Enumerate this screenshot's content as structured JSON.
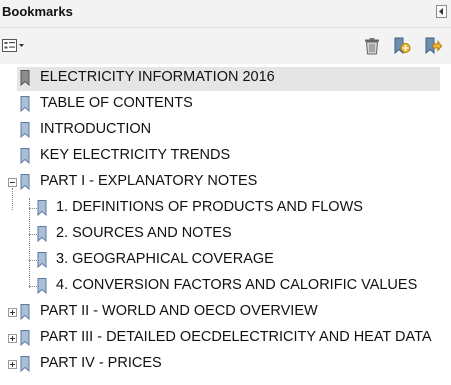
{
  "panel": {
    "title": "Bookmarks",
    "collapse_icon": "triangle-left-icon"
  },
  "toolbar": {
    "options_icon": "options-menu-icon",
    "delete_icon": "trash-icon",
    "new_bookmark_icon": "new-bookmark-icon",
    "expand_bookmark_icon": "expand-bookmark-icon"
  },
  "colors": {
    "selected_row": "#e5e5e5",
    "bookmark_icon": "#7f9db9",
    "header_bg": "#f3f3f3"
  },
  "bookmarks": [
    {
      "label": "ELECTRICITY INFORMATION 2016",
      "level": 0,
      "selected": true
    },
    {
      "label": "TABLE OF CONTENTS",
      "level": 0
    },
    {
      "label": "INTRODUCTION",
      "level": 0
    },
    {
      "label": "KEY ELECTRICITY TRENDS",
      "level": 0
    },
    {
      "label": "PART I - EXPLANATORY NOTES",
      "level": 0,
      "toggle": "collapse"
    },
    {
      "label": "1. DEFINITIONS OF PRODUCTS AND FLOWS",
      "level": 1
    },
    {
      "label": "2. SOURCES AND NOTES",
      "level": 1
    },
    {
      "label": "3. GEOGRAPHICAL COVERAGE",
      "level": 1
    },
    {
      "label": "4. CONVERSION FACTORS AND CALORIFIC VALUES",
      "level": 1
    },
    {
      "label": "PART II - WORLD AND OECD OVERVIEW",
      "level": 0,
      "toggle": "expand"
    },
    {
      "label": "PART III - DETAILED OECDELECTRICITY AND HEAT DATA",
      "level": 0,
      "toggle": "expand"
    },
    {
      "label": "PART IV - PRICES",
      "level": 0,
      "toggle": "expand"
    }
  ]
}
